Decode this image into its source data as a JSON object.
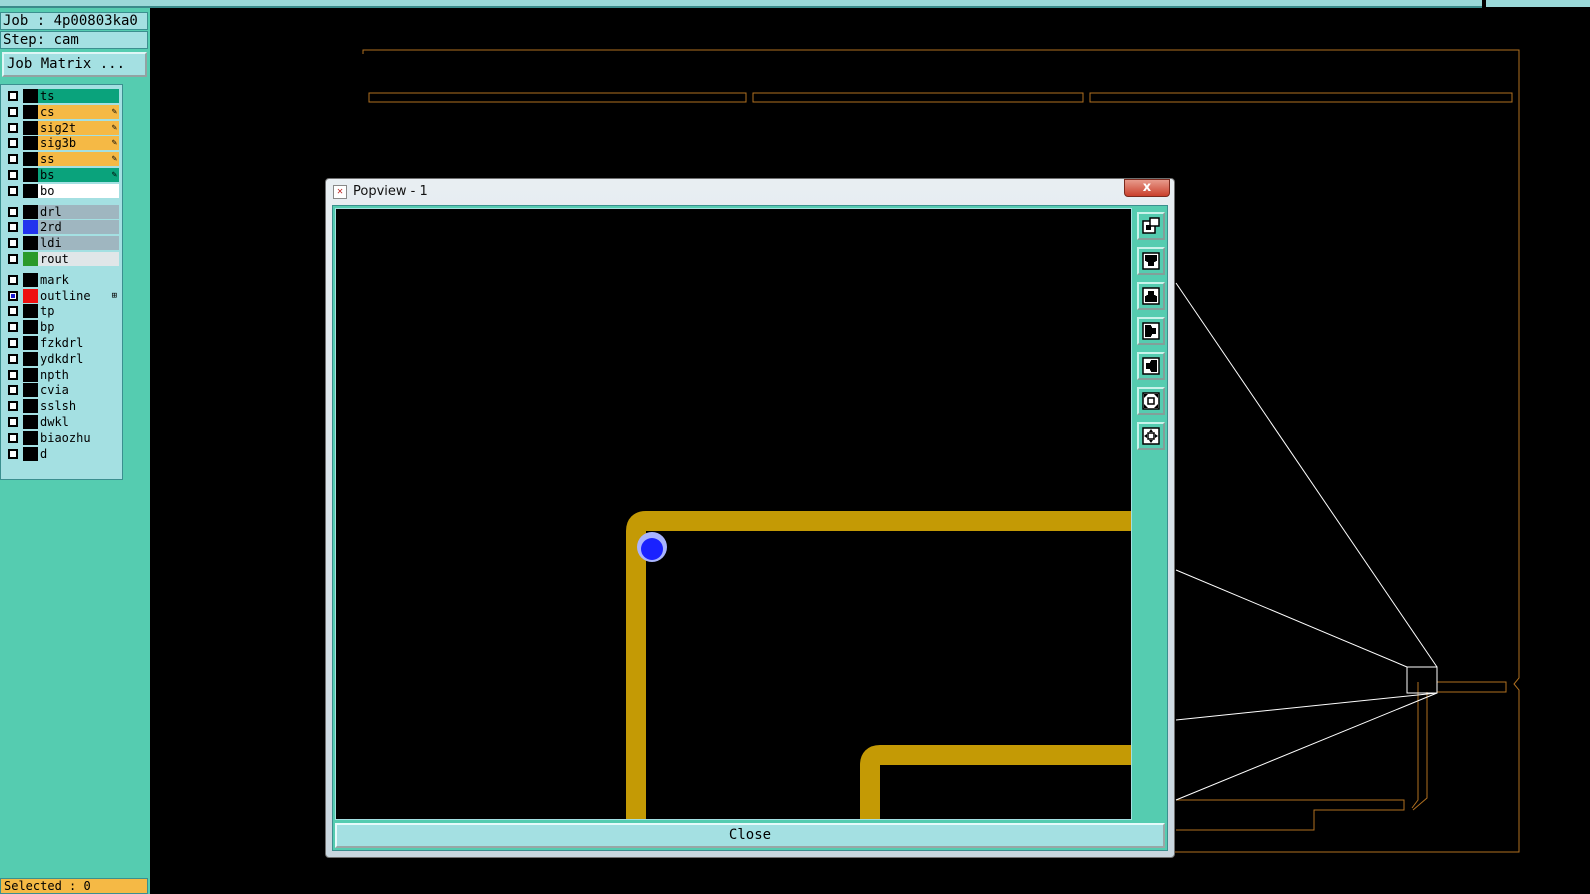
{
  "job_label": "Job : 4p00803ka0",
  "step_label": "Step: cam",
  "job_matrix_label": "Job Matrix ...",
  "selected_label": "Selected : 0",
  "layers": [
    {
      "name": "ts",
      "bg": "#0aa37c",
      "swatch": "#000000",
      "icon": ""
    },
    {
      "name": "cs",
      "bg": "#f5b945",
      "swatch": "#000000",
      "icon": "✎"
    },
    {
      "name": "sig2t",
      "bg": "#f5b945",
      "swatch": "#000000",
      "icon": "✎"
    },
    {
      "name": "sig3b",
      "bg": "#f5b945",
      "swatch": "#000000",
      "icon": "✎"
    },
    {
      "name": "ss",
      "bg": "#f5b945",
      "swatch": "#000000",
      "icon": "✎"
    },
    {
      "name": "bs",
      "bg": "#0aa37c",
      "swatch": "#000000",
      "icon": "✎"
    },
    {
      "name": "bo",
      "bg": "#ffffff",
      "swatch": "#000000",
      "icon": ""
    },
    {
      "name": "drl",
      "bg": "#9fb6c0",
      "swatch": "#000000",
      "icon": ""
    },
    {
      "name": "2rd",
      "bg": "#9fb6c0",
      "swatch": "#2233ee",
      "icon": ""
    },
    {
      "name": "ldi",
      "bg": "#9fb6c0",
      "swatch": "#000000",
      "icon": ""
    },
    {
      "name": "rout",
      "bg": "#e0e6e8",
      "swatch": "#2a9a2a",
      "icon": ""
    },
    {
      "name": "mark",
      "bg": "#a4e0e2",
      "swatch": "#000000",
      "icon": ""
    },
    {
      "name": "outline",
      "bg": "#a4e0e2",
      "swatch": "#ee1111",
      "icon": "⊞",
      "checked": true
    },
    {
      "name": "tp",
      "bg": "#a4e0e2",
      "swatch": "#000000",
      "icon": ""
    },
    {
      "name": "bp",
      "bg": "#a4e0e2",
      "swatch": "#000000",
      "icon": ""
    },
    {
      "name": "fzkdrl",
      "bg": "#a4e0e2",
      "swatch": "#000000",
      "icon": ""
    },
    {
      "name": "ydkdrl",
      "bg": "#a4e0e2",
      "swatch": "#000000",
      "icon": ""
    },
    {
      "name": "npth",
      "bg": "#a4e0e2",
      "swatch": "#000000",
      "icon": ""
    },
    {
      "name": "cvia",
      "bg": "#a4e0e2",
      "swatch": "#000000",
      "icon": ""
    },
    {
      "name": "sslsh",
      "bg": "#a4e0e2",
      "swatch": "#000000",
      "icon": ""
    },
    {
      "name": "dwkl",
      "bg": "#a4e0e2",
      "swatch": "#000000",
      "icon": ""
    },
    {
      "name": "biaozhu",
      "bg": "#a4e0e2",
      "swatch": "#000000",
      "icon": ""
    },
    {
      "name": "d",
      "bg": "#a4e0e2",
      "swatch": "#000000",
      "icon": ""
    }
  ],
  "popup": {
    "title": "Popview - 1",
    "close_x": "x",
    "close_button": "Close",
    "tools": [
      "popout-icon",
      "pan-up-icon",
      "pan-down-icon",
      "pan-left-icon",
      "pan-right-icon",
      "zoom-in-icon",
      "zoom-out-icon"
    ]
  },
  "colors": {
    "teal": "#55ccb0",
    "light_cyan": "#a4e0e2",
    "trace_gold": "#c49a05",
    "outline_orange": "#b07020",
    "pad_blue": "#1a22ff"
  }
}
